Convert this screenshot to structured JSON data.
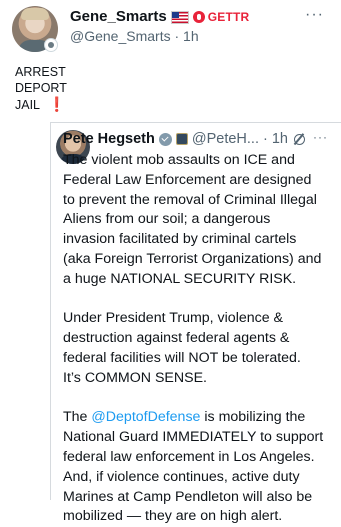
{
  "author": {
    "display_name": "Gene_Smarts",
    "platform_tag": "GETTR",
    "handle": "@Gene_Smarts",
    "time": "1h"
  },
  "post_lines": [
    "ARREST",
    "DEPORT",
    "JAIL"
  ],
  "post_emoji": "❗",
  "quoted": {
    "display_name": "Pete Hegseth",
    "handle": "@PeteH...",
    "time": "1h",
    "lines": [
      "The violent mob assaults on ICE and",
      "Federal Law Enforcement are designed",
      "to prevent the removal of Criminal Illegal",
      "Aliens from our soil; a dangerous",
      "invasion facilitated by criminal cartels",
      "(aka Foreign Terrorist Organizations) and",
      "a huge NATIONAL SECURITY RISK.",
      "",
      "Under President Trump, violence &",
      "destruction against federal agents &",
      "federal facilities will NOT be tolerated.",
      "It’s COMMON SENSE.",
      "",
      "The ",
      "National Guard IMMEDIATELY to support",
      "federal law enforcement in Los Angeles.",
      "And, if violence continues, active duty",
      "Marines at Camp Pendleton will also be",
      "mobilized — they are on high alert."
    ],
    "mention": "@DeptofDefense",
    "mention_tail": " is mobilizing the"
  },
  "icons": {
    "more": "more-options-icon",
    "flag": "us-flag-icon",
    "gettr": "gettr-logo-icon",
    "verified": "gov-verified-icon",
    "grok": "grok-icon"
  },
  "colors": {
    "link": "#1d9bf0",
    "gettr_red": "#e8233a",
    "muted": "#536471"
  }
}
